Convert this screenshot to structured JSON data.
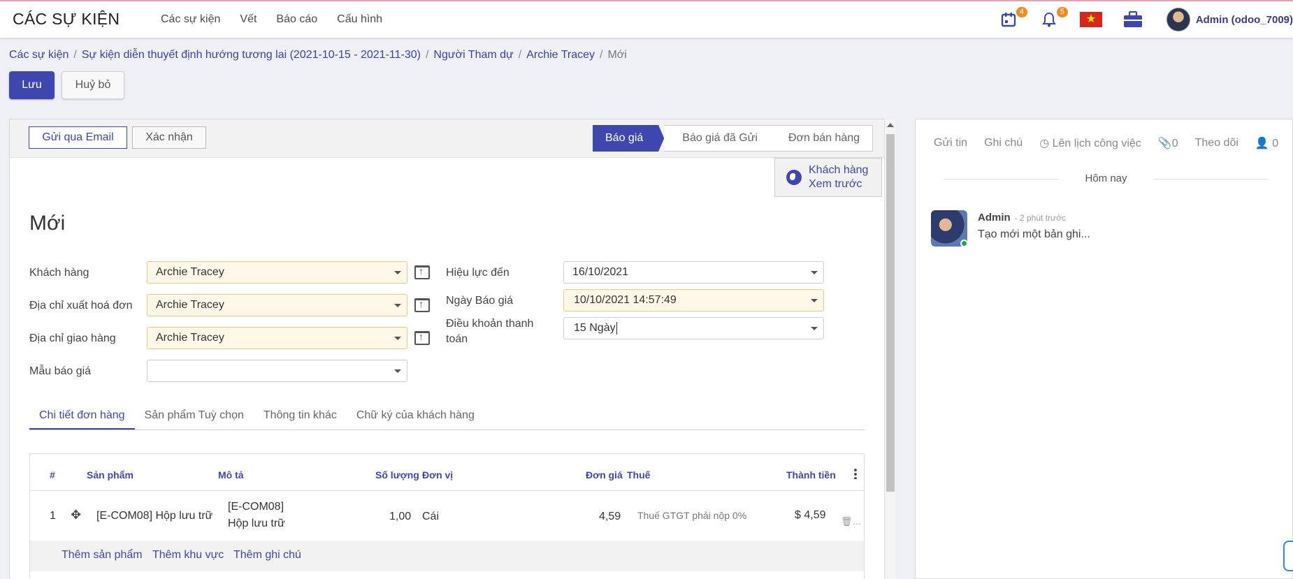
{
  "app": {
    "title": "CÁC SỰ KIỆN"
  },
  "menu": [
    "Các sự kiện",
    "Vết",
    "Báo cáo",
    "Cấu hình"
  ],
  "systray": {
    "activity_count": "4",
    "notification_count": "5",
    "user": "Admin (odoo_7009)"
  },
  "breadcrumb": {
    "items": [
      "Các sự kiện",
      "Sự kiện diễn thuyết định hướng tương lai (2021-10-15 - 2021-11-30)",
      "Người Tham dự",
      "Archie Tracey"
    ],
    "current": "Mới"
  },
  "actions": {
    "save": "Lưu",
    "discard": "Huỷ bỏ"
  },
  "statusbar": {
    "send_email": "Gửi qua Email",
    "confirm": "Xác nhận",
    "stages": [
      "Báo giá",
      "Báo giá đã Gửi",
      "Đơn bán hàng"
    ],
    "active_stage": "Báo giá"
  },
  "preview": {
    "line1": "Khách hàng",
    "line2": "Xem trước"
  },
  "record": {
    "title": "Mới"
  },
  "fields": {
    "customer": {
      "label": "Khách hàng",
      "value": "Archie Tracey"
    },
    "invoice_address": {
      "label": "Địa chỉ xuất hoá đơn",
      "value": "Archie Tracey"
    },
    "delivery_address": {
      "label": "Địa chỉ giao hàng",
      "value": "Archie Tracey"
    },
    "template": {
      "label": "Mẫu báo giá",
      "value": ""
    },
    "validity": {
      "label": "Hiệu lực đến",
      "value": "16/10/2021"
    },
    "quotation_date": {
      "label": "Ngày Báo giá",
      "value": "10/10/2021 14:57:49"
    },
    "payment_terms": {
      "label": "Điều khoản thanh toán",
      "value": "15 Ngày"
    }
  },
  "tabs": [
    "Chi tiết đơn hàng",
    "Sản phẩm Tuỳ chọn",
    "Thông tin khác",
    "Chữ ký của khách hàng"
  ],
  "active_tab": "Chi tiết đơn hàng",
  "order_lines": {
    "columns": [
      "#",
      "Sản phẩm",
      "Mô tả",
      "Số lượng",
      "Đơn vị",
      "Đơn giá",
      "Thuế",
      "Thành tiền"
    ],
    "rows": [
      {
        "seq": "1",
        "product": "[E-COM08] Hộp lưu trữ",
        "desc_line1": "[E-COM08]",
        "desc_line2": "Hộp lưu trữ",
        "qty": "1,00",
        "uom": "Cái",
        "price": "4,59",
        "tax": "Thuế GTGT phải nộp 0%",
        "subtotal": "$ 4,59"
      }
    ],
    "add_product": "Thêm sản phẩm",
    "add_section": "Thêm khu vực",
    "add_note": "Thêm ghi chú"
  },
  "chatter": {
    "send_message": "Gửi tin",
    "log_note": "Ghi chú",
    "schedule": "Lên lịch công việc",
    "attachments": "0",
    "follow": "Theo dõi",
    "followers": "0",
    "today": "Hôm nay",
    "message": {
      "author": "Admin",
      "time": "- 2 phút trước",
      "body": "Tạo mới một bản ghi..."
    }
  }
}
